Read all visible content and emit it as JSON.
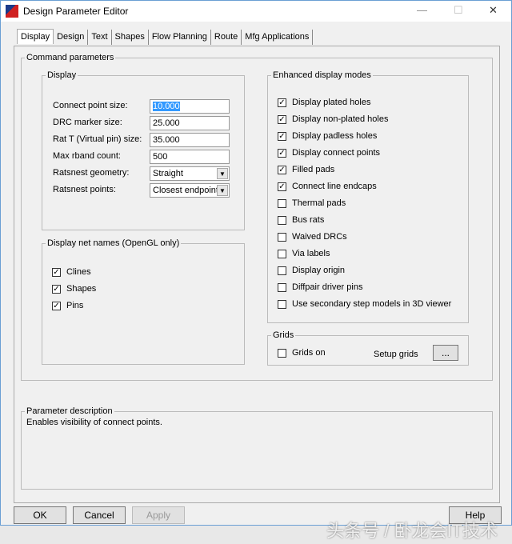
{
  "window": {
    "title": "Design Parameter Editor",
    "minimize": "—",
    "maximize": "☐",
    "close": "✕"
  },
  "tabs": [
    "Display",
    "Design",
    "Text",
    "Shapes",
    "Flow Planning",
    "Route",
    "Mfg Applications"
  ],
  "command_parameters": {
    "title": "Command parameters",
    "display": {
      "title": "Display",
      "fields": [
        {
          "label": "Connect point size:",
          "value": "10.000"
        },
        {
          "label": "DRC marker size:",
          "value": "25.000"
        },
        {
          "label": "Rat T (Virtual pin) size:",
          "value": "35.000"
        },
        {
          "label": "Max rband count:",
          "value": "500"
        }
      ],
      "selects": [
        {
          "label": "Ratsnest geometry:",
          "value": "Straight"
        },
        {
          "label": "Ratsnest points:",
          "value": "Closest endpoint"
        }
      ]
    },
    "net_names": {
      "title": "Display net names (OpenGL only)",
      "items": [
        {
          "label": "Clines",
          "checked": true
        },
        {
          "label": "Shapes",
          "checked": true
        },
        {
          "label": "Pins",
          "checked": true
        }
      ]
    },
    "enhanced": {
      "title": "Enhanced display modes",
      "items": [
        {
          "label": "Display plated holes",
          "checked": true
        },
        {
          "label": "Display non-plated holes",
          "checked": true
        },
        {
          "label": "Display padless holes",
          "checked": true
        },
        {
          "label": "Display connect points",
          "checked": true
        },
        {
          "label": "Filled pads",
          "checked": true
        },
        {
          "label": "Connect line endcaps",
          "checked": true
        },
        {
          "label": "Thermal pads",
          "checked": false
        },
        {
          "label": "Bus rats",
          "checked": false
        },
        {
          "label": "Waived DRCs",
          "checked": false
        },
        {
          "label": "Via labels",
          "checked": false
        },
        {
          "label": "Display origin",
          "checked": false
        },
        {
          "label": "Diffpair driver pins",
          "checked": false
        },
        {
          "label": "Use secondary step models in 3D viewer",
          "checked": false
        }
      ]
    },
    "grids": {
      "title": "Grids",
      "grids_on": "Grids on",
      "setup_label": "Setup grids",
      "setup_button": "..."
    }
  },
  "parameter_description": {
    "title": "Parameter description",
    "text": "Enables visibility of connect points."
  },
  "buttons": {
    "ok": "OK",
    "cancel": "Cancel",
    "apply": "Apply",
    "help": "Help"
  },
  "watermark": "头条号 / 卧龙会IT技术"
}
